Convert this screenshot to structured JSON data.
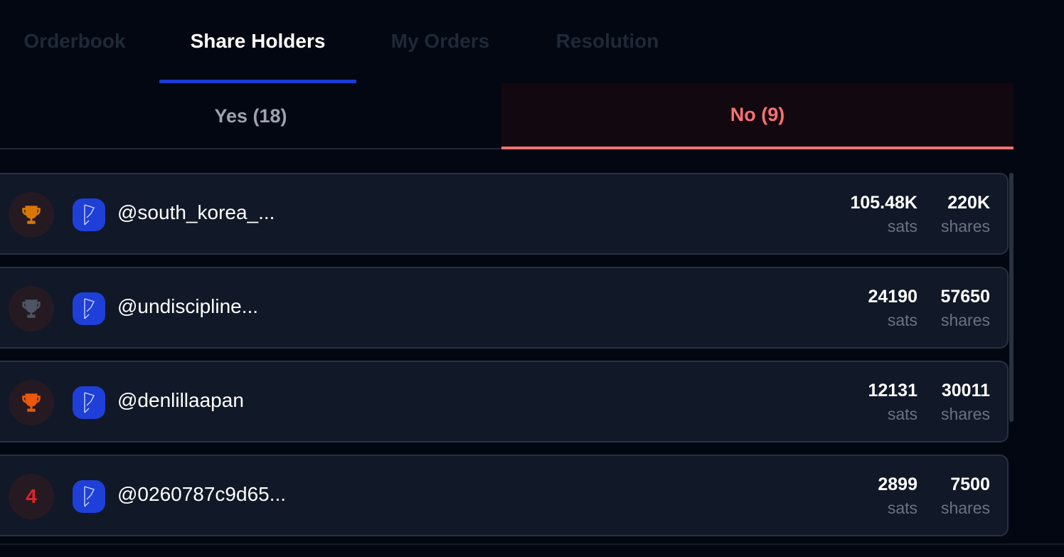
{
  "tabs": [
    {
      "label": "Orderbook",
      "active": false
    },
    {
      "label": "Share Holders",
      "active": true
    },
    {
      "label": "My Orders",
      "active": false
    },
    {
      "label": "Resolution",
      "active": false
    }
  ],
  "subtabs": {
    "yes": "Yes (18)",
    "no": "No (9)",
    "active": "no"
  },
  "colors": {
    "accent": "#1d3bd6",
    "no_red": "#f87171",
    "gold": "#d97706",
    "silver": "#4b5563",
    "bronze": "#ea580c",
    "rank_red": "#dc2626",
    "avatar_blue": "#1e3fd8"
  },
  "holders": [
    {
      "rank_icon": "trophy-gold-icon",
      "rank": "",
      "username": "@south_korea_...",
      "sats": "105.48K",
      "sats_unit": "sats",
      "shares": "220K",
      "shares_unit": "shares"
    },
    {
      "rank_icon": "trophy-silver-icon",
      "rank": "",
      "username": "@undiscipline...",
      "sats": "24190",
      "sats_unit": "sats",
      "shares": "57650",
      "shares_unit": "shares"
    },
    {
      "rank_icon": "trophy-bronze-icon",
      "rank": "",
      "username": "@denlillaapan",
      "sats": "12131",
      "sats_unit": "sats",
      "shares": "30011",
      "shares_unit": "shares"
    },
    {
      "rank_icon": "",
      "rank": "4",
      "username": "@0260787c9d65...",
      "sats": "2899",
      "sats_unit": "sats",
      "shares": "7500",
      "shares_unit": "shares"
    }
  ]
}
